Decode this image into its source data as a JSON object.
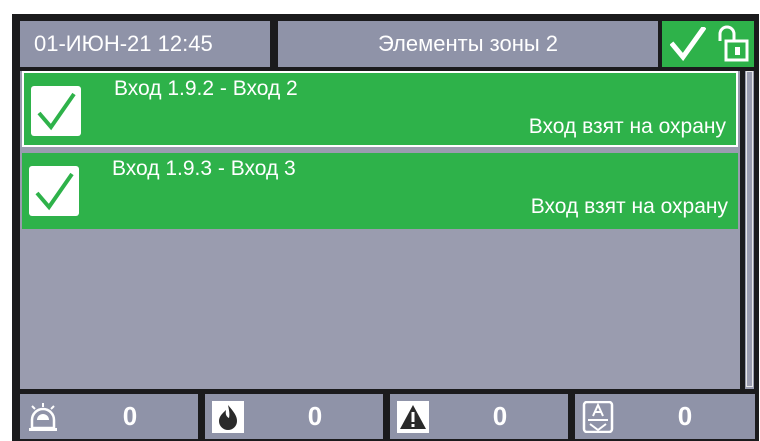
{
  "header": {
    "datetime": "01-ИЮН-21 12:45",
    "title": "Элементы зоны 2",
    "status_icons": [
      "check-icon",
      "unlocked-padlock-icon"
    ]
  },
  "inputs": [
    {
      "name": "Вход 1.9.2 - Вход 2",
      "state": "Вход взят на охрану",
      "selected": true,
      "icon": "check-icon"
    },
    {
      "name": "Вход 1.9.3 - Вход 3",
      "state": "Вход взят на охрану",
      "selected": false,
      "icon": "check-icon"
    }
  ],
  "counters": [
    {
      "icon": "siren-icon",
      "value": "0"
    },
    {
      "icon": "flame-icon",
      "value": "0"
    },
    {
      "icon": "warning-icon",
      "value": "0"
    },
    {
      "icon": "alarm-person-icon",
      "value": "0"
    }
  ],
  "colors": {
    "background": "#1b1b1d",
    "panel": "#8f93a8",
    "list": "#9a9caf",
    "armed": "#2eb24a",
    "text": "#ffffff"
  }
}
